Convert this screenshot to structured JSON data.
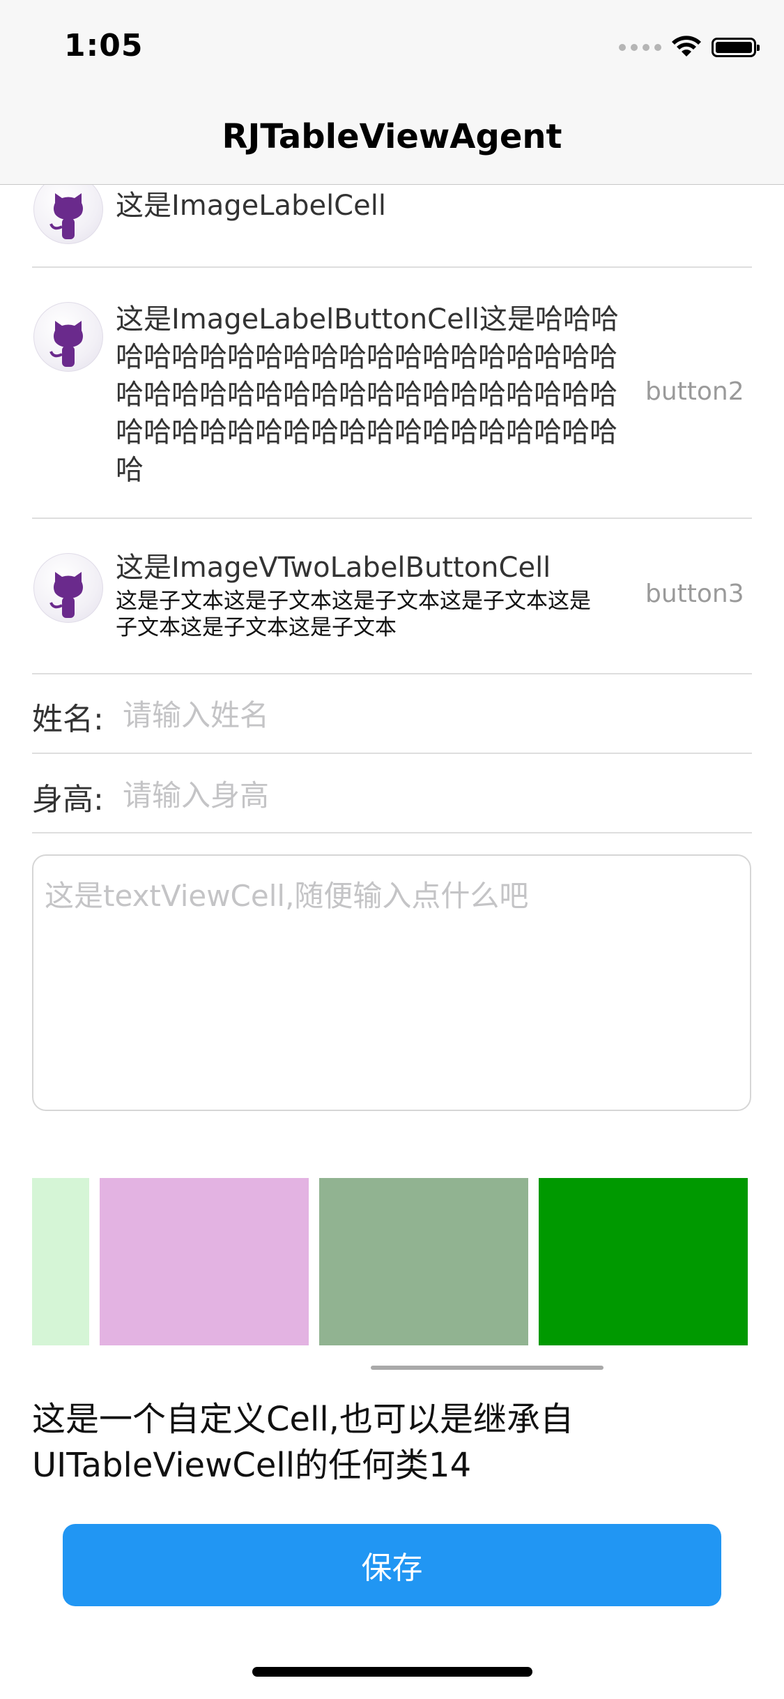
{
  "status_bar": {
    "time": "1:05"
  },
  "nav": {
    "title": "RJTableViewAgent"
  },
  "cells": {
    "image_label": {
      "text": "这是ImageLabelCell"
    },
    "image_label_button": {
      "text": "这是ImageLabelButtonCell这是哈哈哈哈哈哈哈哈哈哈哈哈哈哈哈哈哈哈哈哈哈哈哈哈哈哈哈哈哈哈哈哈哈哈哈哈哈哈哈哈哈哈哈哈哈哈哈哈哈哈哈哈哈哈哈哈哈哈",
      "button": "button2"
    },
    "image_two_label_button": {
      "title": "这是ImageVTwoLabelButtonCell",
      "subtitle": "这是子文本这是子文本这是子文本这是子文本这是子文本这是子文本这是子文本",
      "button": "button3"
    }
  },
  "form": {
    "name_label": "姓名:",
    "name_placeholder": "请输入姓名",
    "height_label": "身高:",
    "height_placeholder": "请输入身高"
  },
  "textview": {
    "placeholder": "这是textViewCell,随便输入点什么吧"
  },
  "color_blocks": [
    "#d5f5d6",
    "#e3b3e2",
    "#91b391",
    "#009900"
  ],
  "custom_cell": {
    "text": "这是一个自定义Cell,也可以是继承自UITableViewCell的任何类14"
  },
  "save_button": {
    "label": "保存"
  },
  "colors": {
    "accent": "#2196f3"
  }
}
